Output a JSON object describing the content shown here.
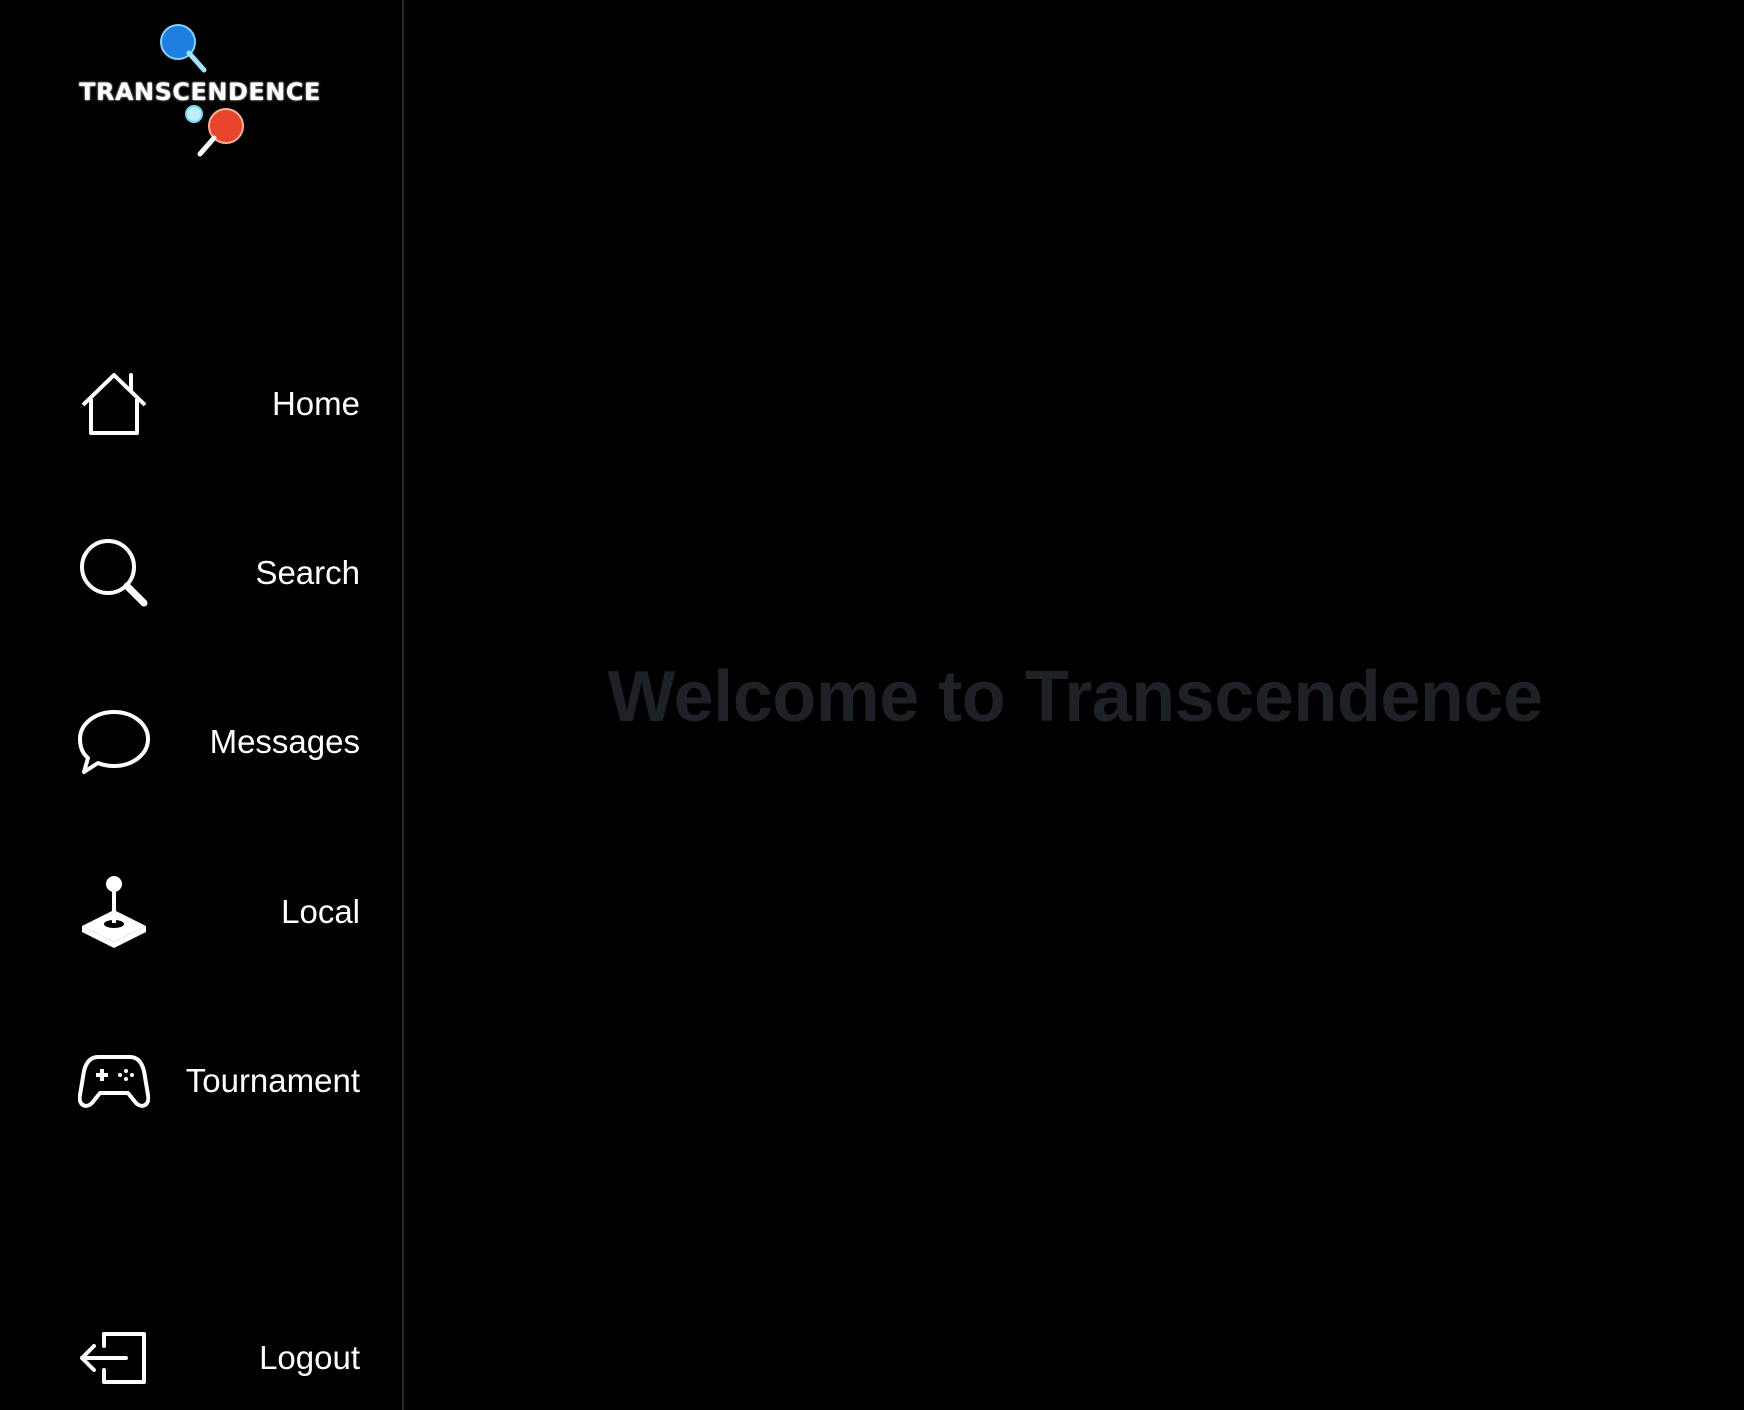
{
  "app": {
    "logo_text": "TRANSCENDENCE"
  },
  "sidebar": {
    "items": [
      {
        "label": "Home",
        "icon": "home-icon"
      },
      {
        "label": "Search",
        "icon": "search-icon"
      },
      {
        "label": "Messages",
        "icon": "chat-bubble-icon"
      },
      {
        "label": "Local",
        "icon": "joystick-icon"
      },
      {
        "label": "Tournament",
        "icon": "gamepad-icon"
      }
    ],
    "logout": {
      "label": "Logout",
      "icon": "logout-icon"
    }
  },
  "main": {
    "welcome_text": "Welcome to Transcendence"
  },
  "colors": {
    "background": "#000000",
    "text": "#ffffff",
    "welcome_text": "#1e2227",
    "paddle_blue": "#1e7fe0",
    "paddle_red": "#e8452a",
    "ball": "#bfefff"
  }
}
